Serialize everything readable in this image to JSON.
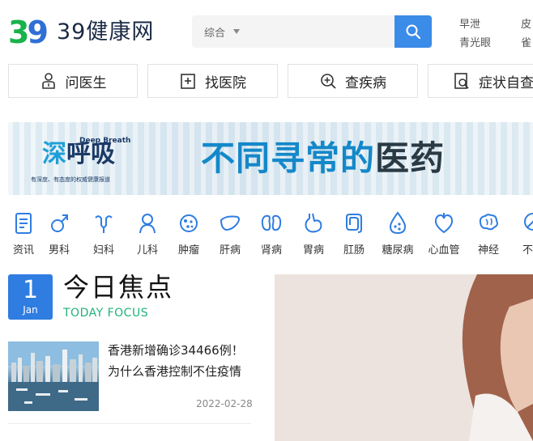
{
  "header": {
    "logo_number": "39",
    "logo_text": "39健康网",
    "search": {
      "category": "综合",
      "placeholder": ""
    },
    "hot_words": [
      "早泄",
      "青光眼",
      "皮",
      "雀"
    ]
  },
  "nav": {
    "items": [
      {
        "label": "问医生",
        "icon": "doctor-icon"
      },
      {
        "label": "找医院",
        "icon": "hospital-icon"
      },
      {
        "label": "查疾病",
        "icon": "disease-search-icon"
      },
      {
        "label": "症状自查",
        "icon": "symptom-check-icon"
      }
    ]
  },
  "banner": {
    "brand_cn_a": "深",
    "brand_cn_b": "呼吸",
    "brand_en": "Deep Breath",
    "brand_tagline": "有深度、有态度的权威健康报道",
    "headline_a": "不同寻常的",
    "headline_b": "医药"
  },
  "categories": [
    {
      "label": "资讯",
      "icon": "news-icon"
    },
    {
      "label": "男科",
      "icon": "male-icon"
    },
    {
      "label": "妇科",
      "icon": "uterus-icon"
    },
    {
      "label": "儿科",
      "icon": "child-icon"
    },
    {
      "label": "肿瘤",
      "icon": "tumor-icon"
    },
    {
      "label": "肝病",
      "icon": "liver-icon"
    },
    {
      "label": "肾病",
      "icon": "kidney-icon"
    },
    {
      "label": "胃病",
      "icon": "stomach-icon"
    },
    {
      "label": "肛肠",
      "icon": "intestine-icon"
    },
    {
      "label": "糖尿病",
      "icon": "diabetes-icon"
    },
    {
      "label": "心血管",
      "icon": "heart-icon"
    },
    {
      "label": "神经",
      "icon": "brain-icon"
    },
    {
      "label": "不孕",
      "icon": "infertility-icon"
    }
  ],
  "focus": {
    "day": "1",
    "month": "Jan",
    "title": "今日焦点",
    "subtitle": "TODAY FOCUS",
    "news": {
      "headline": "香港新增确诊34466例！为什么香港控制不住疫情",
      "date": "2022-02-28"
    }
  },
  "colors": {
    "accent": "#2f7de1",
    "search_button": "#3b8be8",
    "logo_green": "#19b24b",
    "focus_green": "#1fb27a",
    "icon_blue": "#2f7de1"
  }
}
